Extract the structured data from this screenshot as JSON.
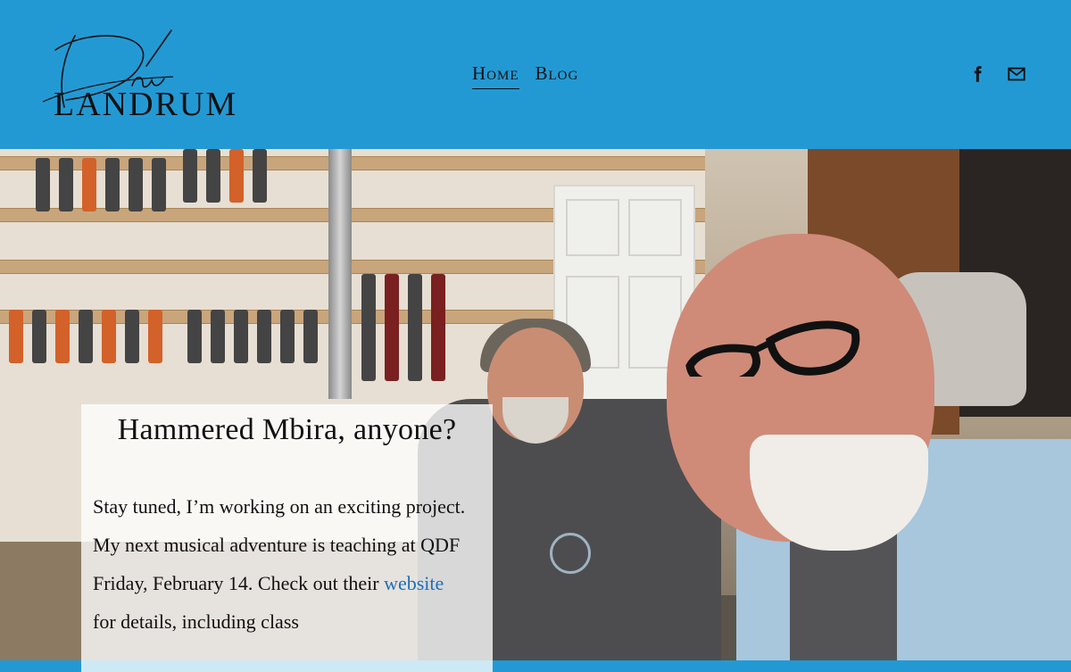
{
  "header": {
    "logo": {
      "script_initials": "Dm",
      "wordmark": "LANDRUM"
    },
    "nav": [
      {
        "label": "Home",
        "active": true
      },
      {
        "label": "Blog",
        "active": false
      }
    ],
    "social": [
      {
        "icon": "facebook-icon"
      },
      {
        "icon": "mail-icon"
      }
    ]
  },
  "hero": {
    "image_alt": "",
    "card": {
      "title": "Hammered Mbira, anyone?",
      "para1": "Stay tuned, I’m working on an exciting project.",
      "para2_start": "My next musical adventure is teaching at QDF Friday, February 14. Check out their ",
      "link_text": "website",
      "para2_end": " for details, including class"
    }
  },
  "colors": {
    "header_bg": "#2399d4",
    "text": "#111111",
    "link": "#1d6fb8",
    "card_bg": "rgba(255,255,255,0.78)"
  }
}
